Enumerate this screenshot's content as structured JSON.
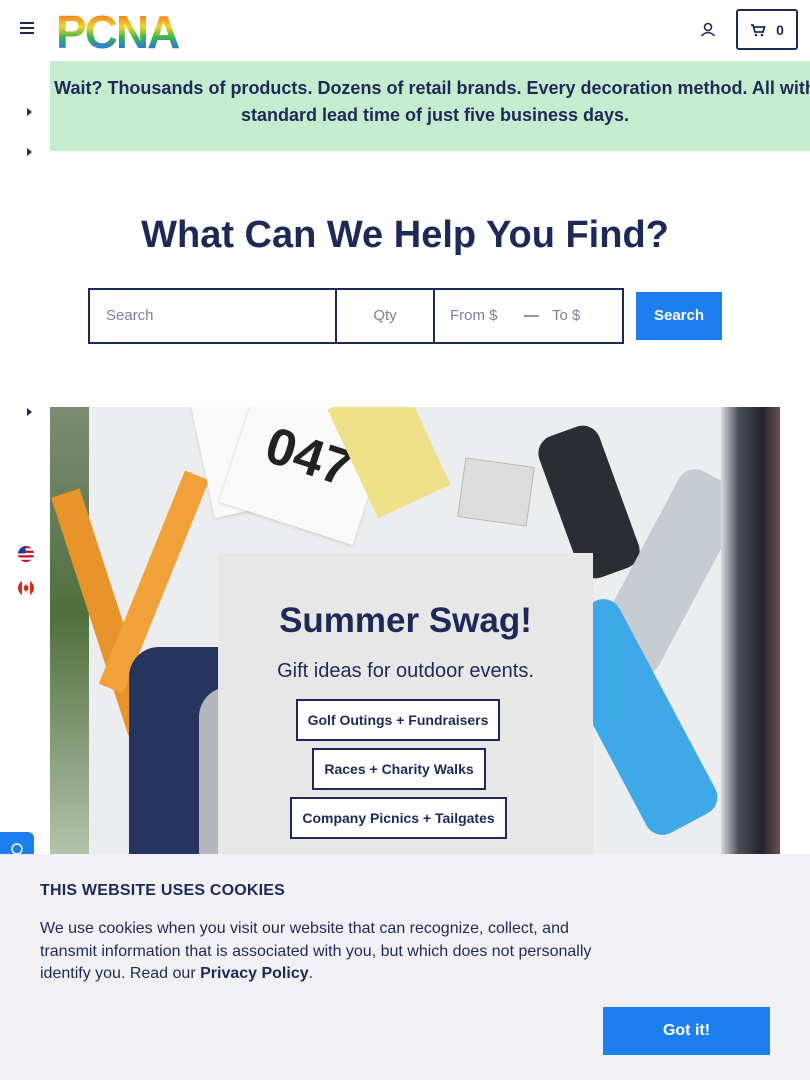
{
  "header": {
    "logo_text": "PCNA",
    "cart_count": "0"
  },
  "banner": {
    "text": "y Wait? Thousands of products. Dozens of retail brands. Every decoration method. All with a standard lead time of just five business days."
  },
  "search": {
    "headline": "What Can We Help You Find?",
    "search_placeholder": "Search",
    "qty_placeholder": "Qty",
    "from_placeholder": "From $",
    "separator": "—",
    "to_placeholder": "To $",
    "button_label": "Search"
  },
  "hero": {
    "title": "Summer Swag!",
    "subtitle": "Gift ideas for outdoor events.",
    "buttons": [
      {
        "label": "Golf Outings + Fundraisers"
      },
      {
        "label": "Races + Charity Walks"
      },
      {
        "label": "Company Picnics + Tailgates"
      }
    ],
    "bib_number": "047"
  },
  "cookie": {
    "title": "THIS WEBSITE USES COOKIES",
    "text": "We use cookies when you visit our website that can recognize, collect, and transmit information that is associated with you, but which does not personally identify you. Read our ",
    "link": "Privacy Policy",
    "suffix": ".",
    "button": "Got it!"
  },
  "icons": [
    "menu-icon",
    "user-icon",
    "cart-icon",
    "chevron-right-icon",
    "us-flag-icon",
    "canada-flag-icon",
    "chat-icon"
  ],
  "colors": {
    "navy": "#1d2a57",
    "accent_blue": "#1b7ff0",
    "banner_green": "#c6ecd0",
    "cookie_bg": "#f1f1f3"
  }
}
